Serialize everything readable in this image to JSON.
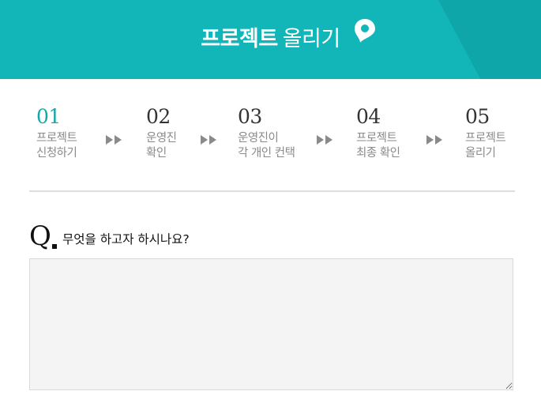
{
  "header": {
    "title_bold": "프로젝트",
    "title_light": "올리기",
    "icon": "location-pin-icon",
    "bg_color": "#12b5b8"
  },
  "steps": [
    {
      "num": "01",
      "line1": "프로젝트",
      "line2": "신청하기",
      "active": true
    },
    {
      "num": "02",
      "line1": "운영진",
      "line2": "확인",
      "active": false
    },
    {
      "num": "03",
      "line1": "운영진이",
      "line2": "각 개인 컨택",
      "active": false
    },
    {
      "num": "04",
      "line1": "프로젝트",
      "line2": "최종 확인",
      "active": false
    },
    {
      "num": "05",
      "line1": "프로젝트",
      "line2": "올리기",
      "active": false
    }
  ],
  "step_arrow_icon": "double-chevron-right-icon",
  "question": {
    "mark": "Q",
    "text": "무엇을 하고자 하시나요?"
  },
  "answer": {
    "value": "",
    "placeholder": ""
  },
  "colors": {
    "accent": "#12a8ab",
    "header": "#12b5b8",
    "step_label": "#8a8a8a"
  }
}
